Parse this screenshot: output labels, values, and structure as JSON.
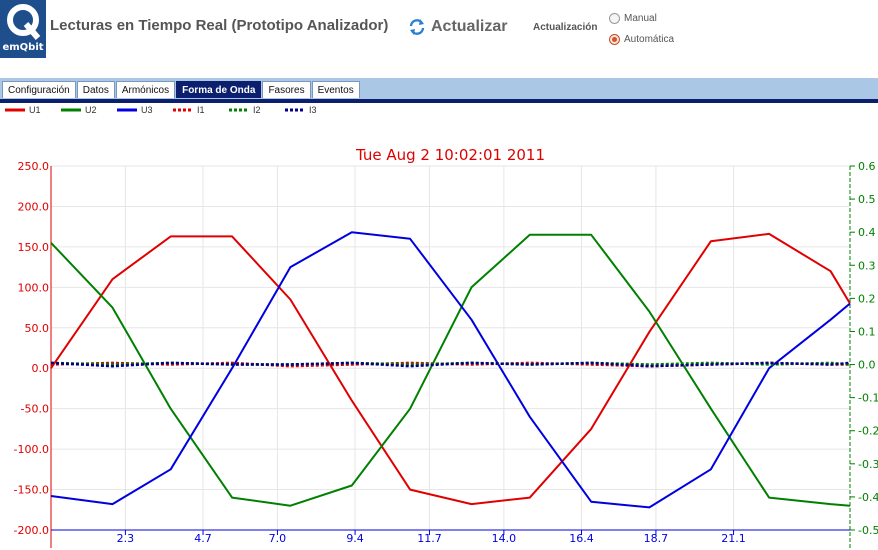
{
  "header": {
    "logo_text": "emQbit",
    "title": "Lecturas en Tiempo Real (Prototipo Analizador)",
    "refresh_label": "Actualizar",
    "update_label": "Actualización",
    "mode_options": [
      {
        "label": "Manual",
        "selected": false
      },
      {
        "label": "Automática",
        "selected": true
      }
    ]
  },
  "tabs": [
    {
      "label": "Configuración",
      "active": false
    },
    {
      "label": "Datos",
      "active": false
    },
    {
      "label": "Armónicos",
      "active": false
    },
    {
      "label": "Forma de Onda",
      "active": true
    },
    {
      "label": "Fasores",
      "active": false
    },
    {
      "label": "Eventos",
      "active": false
    }
  ],
  "chart_data": {
    "type": "line",
    "title": "Tue Aug 2 10:02:01 2011",
    "xlabel": "",
    "ylabel": "",
    "grid": true,
    "legend_position": "top-left",
    "xlim": [
      0,
      24.7
    ],
    "ylim": [
      -200,
      250
    ],
    "y2lim": [
      -0.5,
      0.6
    ],
    "x_ticks": [
      "2.3",
      "4.7",
      "7.0",
      "9.4",
      "11.7",
      "14.0",
      "16.4",
      "18.7",
      "21.1"
    ],
    "y_ticks": [
      "250.0",
      "200.0",
      "150.0",
      "100.0",
      "50.0",
      "0.0",
      "-50.0",
      "-100.0",
      "-150.0",
      "-200.0"
    ],
    "y2_ticks": [
      "0.6",
      "0.5",
      "0.4",
      "0.3",
      "0.2",
      "0.1",
      "0.0",
      "-0.1",
      "-0.2",
      "-0.3",
      "-0.4",
      "-0.5"
    ],
    "x": [
      0,
      1.9,
      3.7,
      5.6,
      7.4,
      9.3,
      11.1,
      13.0,
      14.8,
      16.7,
      18.5,
      20.4,
      22.2,
      24.1,
      24.7
    ],
    "series": [
      {
        "name": "U1",
        "axis": "y",
        "color": "#e00000",
        "dash": false,
        "values": [
          0,
          110,
          163,
          163,
          85,
          -40,
          -150,
          -168,
          -160,
          -75,
          45,
          157,
          166,
          120,
          80
        ]
      },
      {
        "name": "U2",
        "axis": "y",
        "color": "#008000",
        "dash": false,
        "values": [
          155,
          75,
          -50,
          -160,
          -170,
          -145,
          -50,
          100,
          165,
          165,
          70,
          -50,
          -160,
          -168,
          -170
        ]
      },
      {
        "name": "U3",
        "axis": "y",
        "color": "#0000e0",
        "dash": false,
        "values": [
          -158,
          -168,
          -125,
          0,
          125,
          168,
          160,
          60,
          -60,
          -165,
          -172,
          -125,
          0,
          60,
          80
        ]
      },
      {
        "name": "I1",
        "axis": "y2",
        "color": "#e00000",
        "dash": true,
        "values": [
          0.0,
          0.005,
          0.0,
          0.005,
          -0.005,
          0.0,
          0.005,
          0.0,
          0.005,
          0.0,
          -0.005,
          0.0,
          0.005,
          0.0,
          0.0
        ]
      },
      {
        "name": "I2",
        "axis": "y2",
        "color": "#008000",
        "dash": true,
        "values": [
          0.005,
          0.0,
          0.005,
          0.0,
          0.0,
          0.005,
          0.0,
          0.005,
          0.0,
          0.005,
          0.0,
          0.005,
          0.0,
          0.005,
          0.0
        ]
      },
      {
        "name": "I3",
        "axis": "y2",
        "color": "#00008b",
        "dash": true,
        "values": [
          0.005,
          -0.005,
          0.005,
          0.0,
          0.0,
          0.005,
          -0.005,
          0.005,
          0.0,
          0.005,
          -0.005,
          0.0,
          0.005,
          0.0,
          0.005
        ]
      }
    ]
  }
}
